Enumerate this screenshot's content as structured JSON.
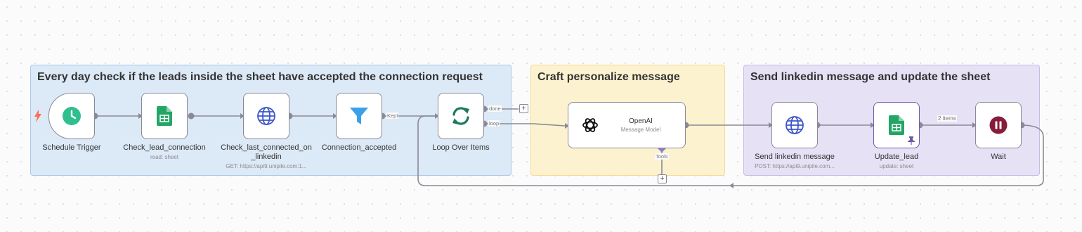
{
  "stickies": {
    "trigger_group": "Every day check if the leads inside the sheet have accepted the connection request",
    "ai_group": "Craft personalize message",
    "send_group": "Send linkedin message and update the sheet"
  },
  "nodes": {
    "schedule_trigger": {
      "label": "Schedule Trigger",
      "icon": "clock-icon"
    },
    "check_lead_connection": {
      "label": "Check_lead_connection",
      "sub": "read: sheet",
      "icon": "google-sheets-icon"
    },
    "check_last_connected": {
      "label": "Check_last_connected_on _linkedin",
      "sub": "GET: https://api9.unipile.com:1...",
      "icon": "globe-icon"
    },
    "connection_accepted": {
      "label": "Connection_accepted",
      "icon": "filter-icon"
    },
    "loop_over_items": {
      "label": "Loop Over Items",
      "icon": "loop-icon"
    },
    "openai": {
      "title": "OpenAI",
      "sub": "Message Model",
      "icon": "openai-icon"
    },
    "send_linkedin_message": {
      "label": "Send linkedin message",
      "sub": "POST: https://api9.unipile.com...",
      "icon": "globe-icon"
    },
    "update_lead": {
      "label": "Update_lead",
      "sub": "update: sheet",
      "icon": "google-sheets-icon"
    },
    "wait": {
      "label": "Wait",
      "icon": "pause-icon"
    }
  },
  "connections": {
    "kept": "Kept",
    "done": "done",
    "loop": "loop",
    "tools": "Tools",
    "items_count": "2 items"
  },
  "colors": {
    "accent": "#ff6d5a",
    "sheets_green": "#23a566",
    "globe_blue": "#3d57c8",
    "filter_blue": "#3aa0e8",
    "loop_green": "#1f7a57",
    "wait_maroon": "#861c3b",
    "clock_teal": "#2fbf8e",
    "pin_purple": "#6b5ca8"
  }
}
